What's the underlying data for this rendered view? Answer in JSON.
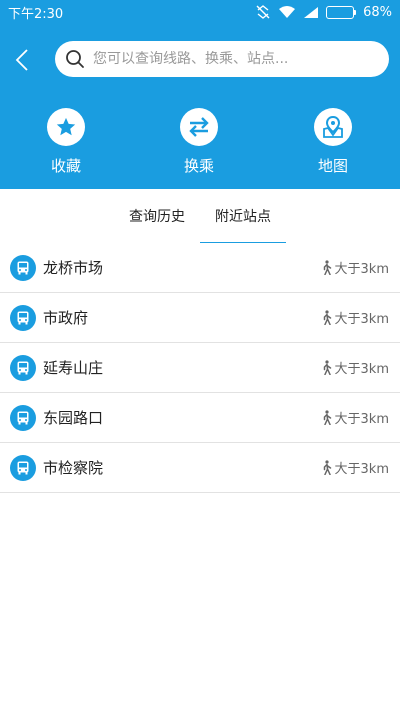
{
  "status_bar": {
    "time": "下午2:30",
    "battery": "68%",
    "battery_level": 0.68
  },
  "search": {
    "placeholder": "您可以查询线路、换乘、站点..."
  },
  "actions": [
    {
      "label": "收藏",
      "icon": "star-icon"
    },
    {
      "label": "换乘",
      "icon": "transfer-arrows-icon"
    },
    {
      "label": "地图",
      "icon": "map-pin-icon"
    }
  ],
  "tabs": [
    {
      "label": "查询历史",
      "active": false
    },
    {
      "label": "附近站点",
      "active": true
    }
  ],
  "stops": [
    {
      "name": "龙桥市场",
      "distance": "大于3km"
    },
    {
      "name": "市政府",
      "distance": "大于3km"
    },
    {
      "name": "延寿山庄",
      "distance": "大于3km"
    },
    {
      "name": "东园路口",
      "distance": "大于3km"
    },
    {
      "name": "市检察院",
      "distance": "大于3km"
    }
  ],
  "colors": {
    "primary": "#1a9de0",
    "background": "#ffffff",
    "divider": "#e2e2e2"
  }
}
